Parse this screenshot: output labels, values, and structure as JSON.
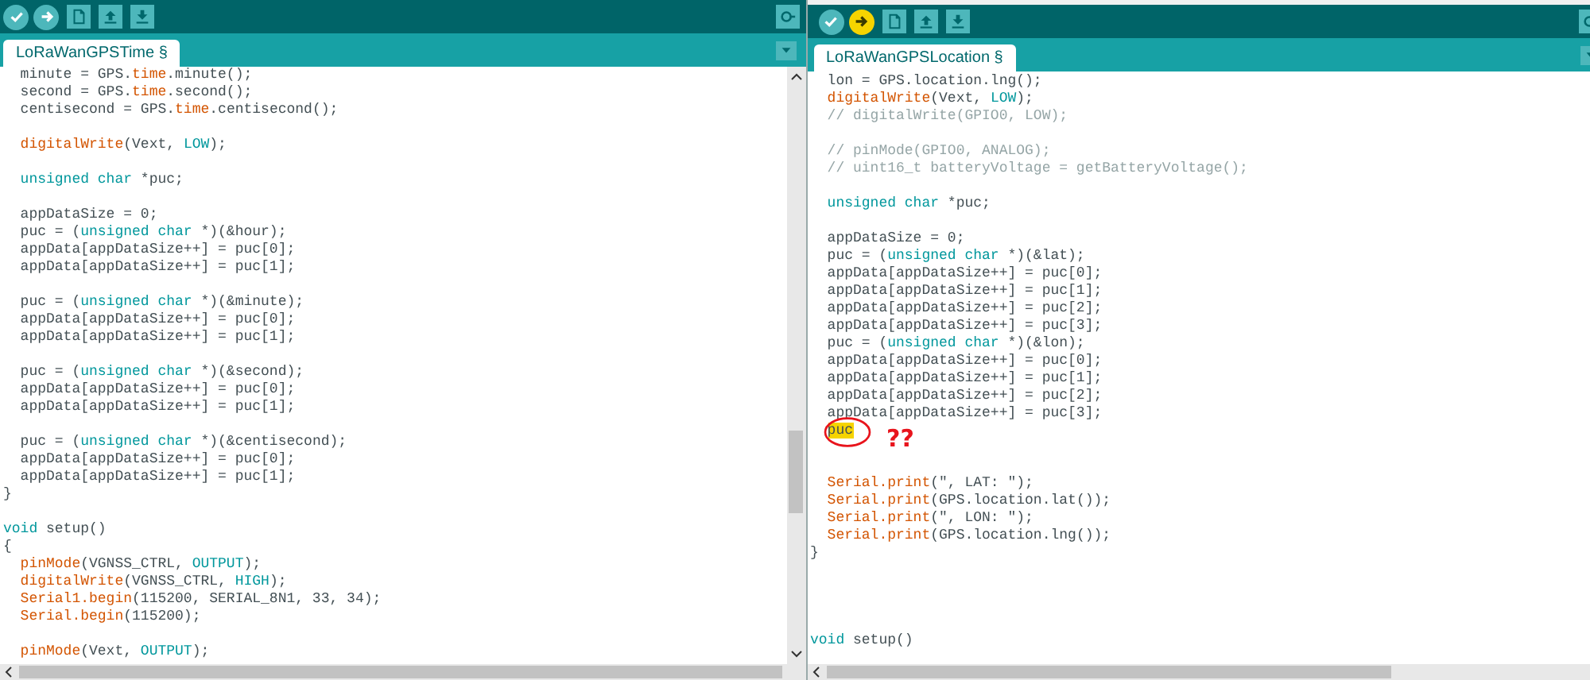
{
  "windows": [
    {
      "toolbar": {
        "buttons": [
          {
            "kind": "verify",
            "highlighted": false
          },
          {
            "kind": "upload",
            "highlighted": false
          },
          {
            "kind": "new",
            "highlighted": false
          },
          {
            "kind": "open",
            "highlighted": false
          },
          {
            "kind": "save",
            "highlighted": false
          }
        ]
      },
      "tab": {
        "label": "LoRaWanGPSTime §",
        "selected": true
      },
      "lines": [
        {
          "kind": "code",
          "segments": [
            {
              "text": "  minute = GPS.",
              "kind": "plain"
            },
            {
              "text": "time",
              "kind": "func"
            },
            {
              "text": ".minute();",
              "kind": "plain"
            }
          ]
        },
        {
          "kind": "code",
          "segments": [
            {
              "text": "  second = GPS.",
              "kind": "plain"
            },
            {
              "text": "time",
              "kind": "func"
            },
            {
              "text": ".second();",
              "kind": "plain"
            }
          ]
        },
        {
          "kind": "code",
          "segments": [
            {
              "text": "  centisecond = GPS.",
              "kind": "plain"
            },
            {
              "text": "time",
              "kind": "func"
            },
            {
              "text": ".centisecond();",
              "kind": "plain"
            }
          ]
        },
        {
          "kind": "blank"
        },
        {
          "kind": "code",
          "segments": [
            {
              "text": "  digitalWrite",
              "kind": "func"
            },
            {
              "text": "(Vext, ",
              "kind": "plain"
            },
            {
              "text": "LOW",
              "kind": "const"
            },
            {
              "text": ");",
              "kind": "plain"
            }
          ]
        },
        {
          "kind": "blank"
        },
        {
          "kind": "code",
          "segments": [
            {
              "text": "  unsigned char",
              "kind": "type"
            },
            {
              "text": " *puc;",
              "kind": "plain"
            }
          ]
        },
        {
          "kind": "blank"
        },
        {
          "kind": "code",
          "segments": [
            {
              "text": "  appDataSize = 0;",
              "kind": "plain"
            }
          ]
        },
        {
          "kind": "code",
          "segments": [
            {
              "text": "  puc = (",
              "kind": "plain"
            },
            {
              "text": "unsigned char",
              "kind": "type"
            },
            {
              "text": " *)(&hour);",
              "kind": "plain"
            }
          ]
        },
        {
          "kind": "code",
          "segments": [
            {
              "text": "  appData[appDataSize++] = puc[0];",
              "kind": "plain"
            }
          ]
        },
        {
          "kind": "code",
          "segments": [
            {
              "text": "  appData[appDataSize++] = puc[1];",
              "kind": "plain"
            }
          ]
        },
        {
          "kind": "blank"
        },
        {
          "kind": "code",
          "segments": [
            {
              "text": "  puc = (",
              "kind": "plain"
            },
            {
              "text": "unsigned char",
              "kind": "type"
            },
            {
              "text": " *)(&minute);",
              "kind": "plain"
            }
          ]
        },
        {
          "kind": "code",
          "segments": [
            {
              "text": "  appData[appDataSize++] = puc[0];",
              "kind": "plain"
            }
          ]
        },
        {
          "kind": "code",
          "segments": [
            {
              "text": "  appData[appDataSize++] = puc[1];",
              "kind": "plain"
            }
          ]
        },
        {
          "kind": "blank"
        },
        {
          "kind": "code",
          "segments": [
            {
              "text": "  puc = (",
              "kind": "plain"
            },
            {
              "text": "unsigned char",
              "kind": "type"
            },
            {
              "text": " *)(&second);",
              "kind": "plain"
            }
          ]
        },
        {
          "kind": "code",
          "segments": [
            {
              "text": "  appData[appDataSize++] = puc[0];",
              "kind": "plain"
            }
          ]
        },
        {
          "kind": "code",
          "segments": [
            {
              "text": "  appData[appDataSize++] = puc[1];",
              "kind": "plain"
            }
          ]
        },
        {
          "kind": "blank"
        },
        {
          "kind": "code",
          "segments": [
            {
              "text": "  puc = (",
              "kind": "plain"
            },
            {
              "text": "unsigned char",
              "kind": "type"
            },
            {
              "text": " *)(&centisecond);",
              "kind": "plain"
            }
          ]
        },
        {
          "kind": "code",
          "segments": [
            {
              "text": "  appData[appDataSize++] = puc[0];",
              "kind": "plain"
            }
          ]
        },
        {
          "kind": "code",
          "segments": [
            {
              "text": "  appData[appDataSize++] = puc[1];",
              "kind": "plain"
            }
          ]
        },
        {
          "kind": "code",
          "segments": [
            {
              "text": "}",
              "kind": "plain"
            }
          ]
        },
        {
          "kind": "blank"
        },
        {
          "kind": "code",
          "segments": [
            {
              "text": "void",
              "kind": "type"
            },
            {
              "text": " setup()",
              "kind": "plain"
            }
          ]
        },
        {
          "kind": "code",
          "segments": [
            {
              "text": "{",
              "kind": "plain"
            }
          ]
        },
        {
          "kind": "code",
          "segments": [
            {
              "text": "  pinMode",
              "kind": "func"
            },
            {
              "text": "(VGNSS_CTRL, ",
              "kind": "plain"
            },
            {
              "text": "OUTPUT",
              "kind": "const"
            },
            {
              "text": ");",
              "kind": "plain"
            }
          ]
        },
        {
          "kind": "code",
          "segments": [
            {
              "text": "  digitalWrite",
              "kind": "func"
            },
            {
              "text": "(VGNSS_CTRL, ",
              "kind": "plain"
            },
            {
              "text": "HIGH",
              "kind": "const"
            },
            {
              "text": ");",
              "kind": "plain"
            }
          ]
        },
        {
          "kind": "code",
          "segments": [
            {
              "text": "  Serial1.begin",
              "kind": "func"
            },
            {
              "text": "(115200, SERIAL_8N1, 33, 34);",
              "kind": "plain"
            }
          ]
        },
        {
          "kind": "code",
          "segments": [
            {
              "text": "  Serial.begin",
              "kind": "func"
            },
            {
              "text": "(115200);",
              "kind": "plain"
            }
          ]
        },
        {
          "kind": "blank"
        },
        {
          "kind": "code",
          "segments": [
            {
              "text": "  pinMode",
              "kind": "func"
            },
            {
              "text": "(Vext, ",
              "kind": "plain"
            },
            {
              "text": "OUTPUT",
              "kind": "const"
            },
            {
              "text": ");",
              "kind": "plain"
            }
          ]
        }
      ]
    },
    {
      "toolbar": {
        "buttons": [
          {
            "kind": "verify",
            "highlighted": false
          },
          {
            "kind": "upload",
            "highlighted": true
          },
          {
            "kind": "new",
            "highlighted": false
          },
          {
            "kind": "open",
            "highlighted": false
          },
          {
            "kind": "save",
            "highlighted": false
          }
        ]
      },
      "tab": {
        "label": "LoRaWanGPSLocation §",
        "selected": true
      },
      "lines": [
        {
          "kind": "code",
          "segments": [
            {
              "text": "  lon = GPS.location.lng();",
              "kind": "plain"
            }
          ]
        },
        {
          "kind": "code",
          "segments": [
            {
              "text": "  digitalWrite",
              "kind": "func"
            },
            {
              "text": "(Vext, ",
              "kind": "plain"
            },
            {
              "text": "LOW",
              "kind": "const"
            },
            {
              "text": ");",
              "kind": "plain"
            }
          ]
        },
        {
          "kind": "code",
          "segments": [
            {
              "text": "  // digitalWrite(GPIO0, LOW);",
              "kind": "comment"
            }
          ]
        },
        {
          "kind": "blank"
        },
        {
          "kind": "code",
          "segments": [
            {
              "text": "  // pinMode(GPIO0, ANALOG);",
              "kind": "comment"
            }
          ]
        },
        {
          "kind": "code",
          "segments": [
            {
              "text": "  // uint16_t batteryVoltage = getBatteryVoltage();",
              "kind": "comment"
            }
          ]
        },
        {
          "kind": "blank"
        },
        {
          "kind": "code",
          "segments": [
            {
              "text": "  unsigned char",
              "kind": "type"
            },
            {
              "text": " *puc;",
              "kind": "plain"
            }
          ]
        },
        {
          "kind": "blank"
        },
        {
          "kind": "code",
          "segments": [
            {
              "text": "  appDataSize = 0;",
              "kind": "plain"
            }
          ]
        },
        {
          "kind": "code",
          "segments": [
            {
              "text": "  puc = (",
              "kind": "plain"
            },
            {
              "text": "unsigned char",
              "kind": "type"
            },
            {
              "text": " *)(&lat);",
              "kind": "plain"
            }
          ]
        },
        {
          "kind": "code",
          "segments": [
            {
              "text": "  appData[appDataSize++] = puc[0];",
              "kind": "plain"
            }
          ]
        },
        {
          "kind": "code",
          "segments": [
            {
              "text": "  appData[appDataSize++] = puc[1];",
              "kind": "plain"
            }
          ]
        },
        {
          "kind": "code",
          "segments": [
            {
              "text": "  appData[appDataSize++] = puc[2];",
              "kind": "plain"
            }
          ]
        },
        {
          "kind": "code",
          "segments": [
            {
              "text": "  appData[appDataSize++] = puc[3];",
              "kind": "plain"
            }
          ]
        },
        {
          "kind": "code",
          "segments": [
            {
              "text": "  puc = (",
              "kind": "plain"
            },
            {
              "text": "unsigned char",
              "kind": "type"
            },
            {
              "text": " *)(&lon);",
              "kind": "plain"
            }
          ]
        },
        {
          "kind": "code",
          "segments": [
            {
              "text": "  appData[appDataSize++] = puc[0];",
              "kind": "plain"
            }
          ]
        },
        {
          "kind": "code",
          "segments": [
            {
              "text": "  appData[appDataSize++] = puc[1];",
              "kind": "plain"
            }
          ]
        },
        {
          "kind": "code",
          "segments": [
            {
              "text": "  appData[appDataSize++] = puc[2];",
              "kind": "plain"
            }
          ]
        },
        {
          "kind": "code",
          "segments": [
            {
              "text": "  appData[appDataSize++] = puc[3];",
              "kind": "plain"
            }
          ]
        },
        {
          "kind": "code",
          "annotation": "??",
          "segments": [
            {
              "text": "  puc",
              "kind": "mark"
            }
          ]
        },
        {
          "kind": "blank"
        },
        {
          "kind": "blank"
        },
        {
          "kind": "code",
          "segments": [
            {
              "text": "  Serial.print",
              "kind": "func"
            },
            {
              "text": "(\", LAT: \");",
              "kind": "plain"
            }
          ]
        },
        {
          "kind": "code",
          "segments": [
            {
              "text": "  Serial.print",
              "kind": "func"
            },
            {
              "text": "(GPS.location.lat());",
              "kind": "plain"
            }
          ]
        },
        {
          "kind": "code",
          "segments": [
            {
              "text": "  Serial.print",
              "kind": "func"
            },
            {
              "text": "(\", LON: \");",
              "kind": "plain"
            }
          ]
        },
        {
          "kind": "code",
          "segments": [
            {
              "text": "  Serial.print",
              "kind": "func"
            },
            {
              "text": "(GPS.location.lng());",
              "kind": "plain"
            }
          ]
        },
        {
          "kind": "code",
          "segments": [
            {
              "text": "}",
              "kind": "plain"
            }
          ]
        },
        {
          "kind": "blank"
        },
        {
          "kind": "blank"
        },
        {
          "kind": "blank"
        },
        {
          "kind": "blank"
        },
        {
          "kind": "code",
          "segments": [
            {
              "text": "void",
              "kind": "type"
            },
            {
              "text": " setup()",
              "kind": "plain"
            }
          ]
        }
      ]
    }
  ]
}
